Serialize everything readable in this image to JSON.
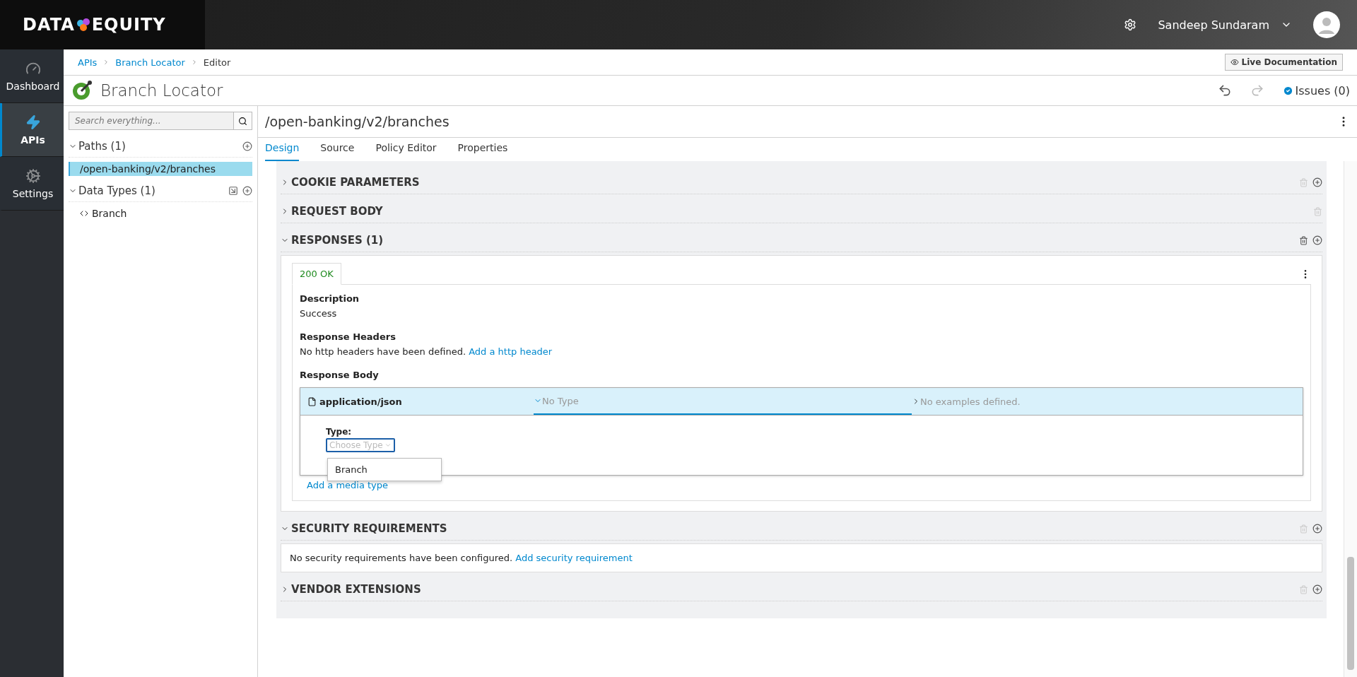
{
  "header": {
    "logo_left": "DATA",
    "logo_right": "EQUITY",
    "user": "Sandeep Sundaram"
  },
  "nav": [
    {
      "kind": "dashboard",
      "label": "Dashboard",
      "selected": false
    },
    {
      "kind": "apis",
      "label": "APIs",
      "selected": true
    },
    {
      "kind": "settings",
      "label": "Settings",
      "selected": false
    }
  ],
  "breadcrumbs": [
    {
      "label": "APIs",
      "link": true
    },
    {
      "label": "Branch Locator",
      "link": true
    },
    {
      "label": "Editor",
      "link": false
    }
  ],
  "live_doc_button": "Live Documentation",
  "api_title": "Branch Locator",
  "issues": "Issues (0)",
  "search": {
    "placeholder": "Search everything..."
  },
  "tree": [
    {
      "title": "Paths (1)",
      "expanded": true,
      "importable": false,
      "items": [
        {
          "kind": "path",
          "label": "/open-banking/v2/branches",
          "selected": true
        }
      ]
    },
    {
      "title": "Data Types (1)",
      "expanded": true,
      "importable": true,
      "items": [
        {
          "kind": "type",
          "label": "Branch",
          "selected": false
        }
      ]
    }
  ],
  "path_title": "/open-banking/v2/branches",
  "tabs": [
    {
      "label": "Design",
      "selected": true
    },
    {
      "label": "Source",
      "selected": false
    },
    {
      "label": "Policy Editor",
      "selected": false
    },
    {
      "label": "Properties",
      "selected": false
    }
  ],
  "sections": [
    {
      "title": "COOKIE PARAMETERS",
      "expanded": false,
      "can_delete": false,
      "can_add": true
    },
    {
      "title": "REQUEST BODY",
      "expanded": false,
      "can_delete": false,
      "can_add": false
    },
    {
      "title": "RESPONSES (1)",
      "expanded": true,
      "can_delete": true,
      "can_add": true,
      "kind": "responses"
    },
    {
      "title": "SECURITY REQUIREMENTS",
      "expanded": true,
      "can_delete": false,
      "can_add": true,
      "kind": "message",
      "message": "No security requirements have been configured.",
      "link": "Add security requirement"
    },
    {
      "title": "VENDOR EXTENSIONS",
      "expanded": false,
      "can_delete": false,
      "can_add": true
    }
  ],
  "response": {
    "tab": "200 OK",
    "description_label": "Description",
    "description": "Success",
    "headers_label": "Response Headers",
    "headers_message": "No http headers have been defined.",
    "headers_link": "Add a http header",
    "body_label": "Response Body",
    "media": {
      "name": "application/json",
      "type": "No Type",
      "examples": "No examples defined.",
      "type_label": "Type:",
      "select_placeholder": "Choose Type",
      "options": [
        "Branch"
      ]
    },
    "add_media_link": "Add a media type"
  }
}
